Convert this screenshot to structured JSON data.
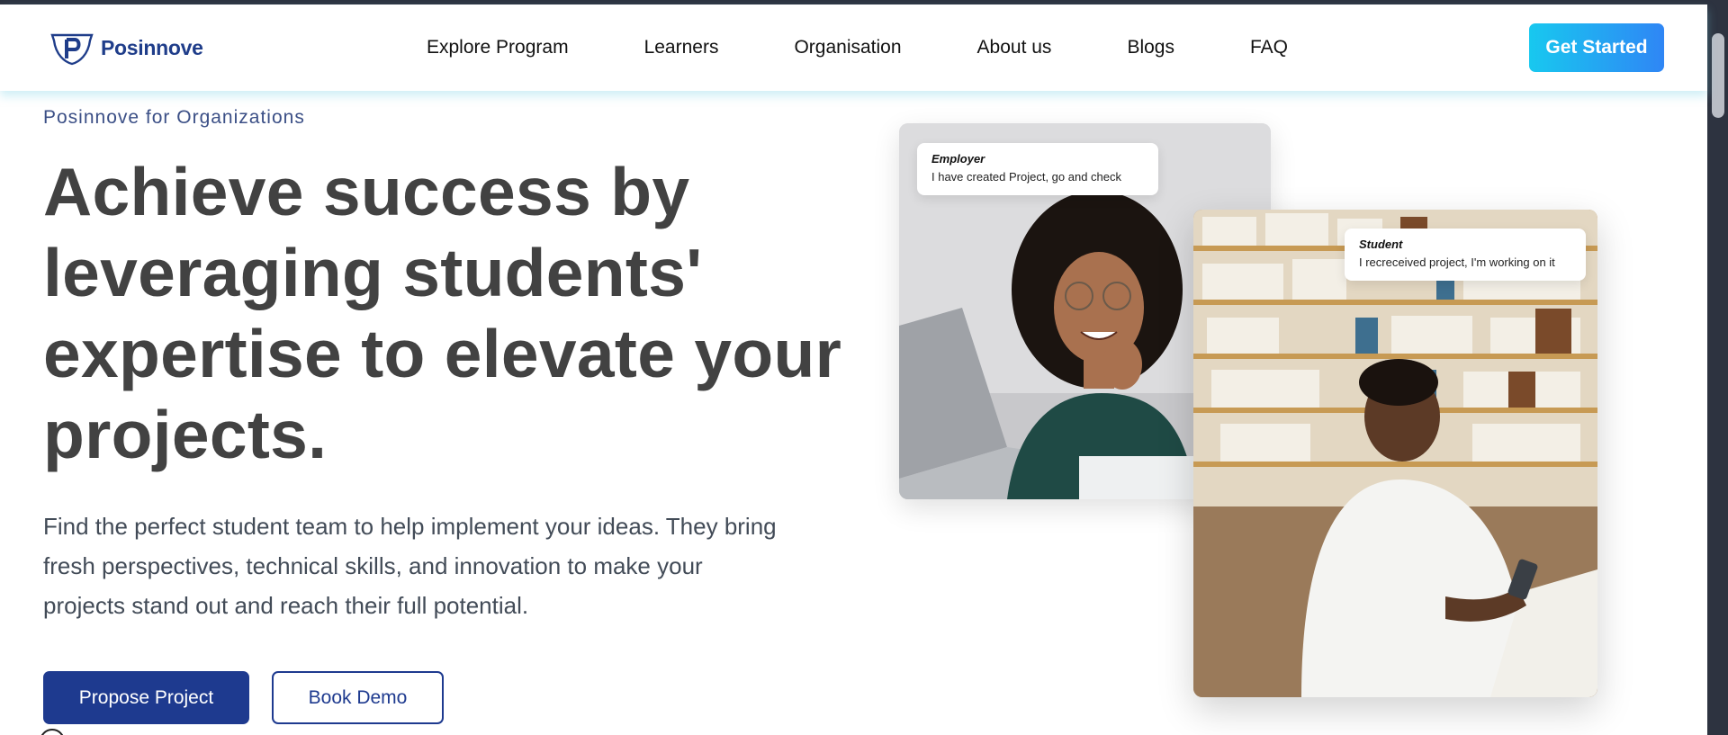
{
  "brand": {
    "name": "Posinnove",
    "logo_icon": "shield-p-logo",
    "color": "#1f3d8a"
  },
  "nav": {
    "links": [
      "Explore Program",
      "Learners",
      "Organisation",
      "About us",
      "Blogs",
      "FAQ"
    ],
    "cta_label": "Get Started"
  },
  "hero": {
    "eyebrow": "Posinnove for Organizations",
    "headline": "Achieve success by leveraging students' expertise to elevate your projects.",
    "description": "Find the perfect student team to help implement your ideas. They bring fresh perspectives, technical skills, and innovation to make your projects stand out and reach their full potential.",
    "primary_button": "Propose Project",
    "secondary_button": "Book Demo"
  },
  "cards": {
    "employer": {
      "title": "Employer",
      "message": "I have created  Project, go and check"
    },
    "student": {
      "title": "Student",
      "message": "I recreceived project, I'm working on it"
    }
  },
  "colors": {
    "primary": "#1e3a8f",
    "cta_start": "#18c8ef",
    "cta_end": "#2f86f5",
    "headline": "#424242"
  }
}
